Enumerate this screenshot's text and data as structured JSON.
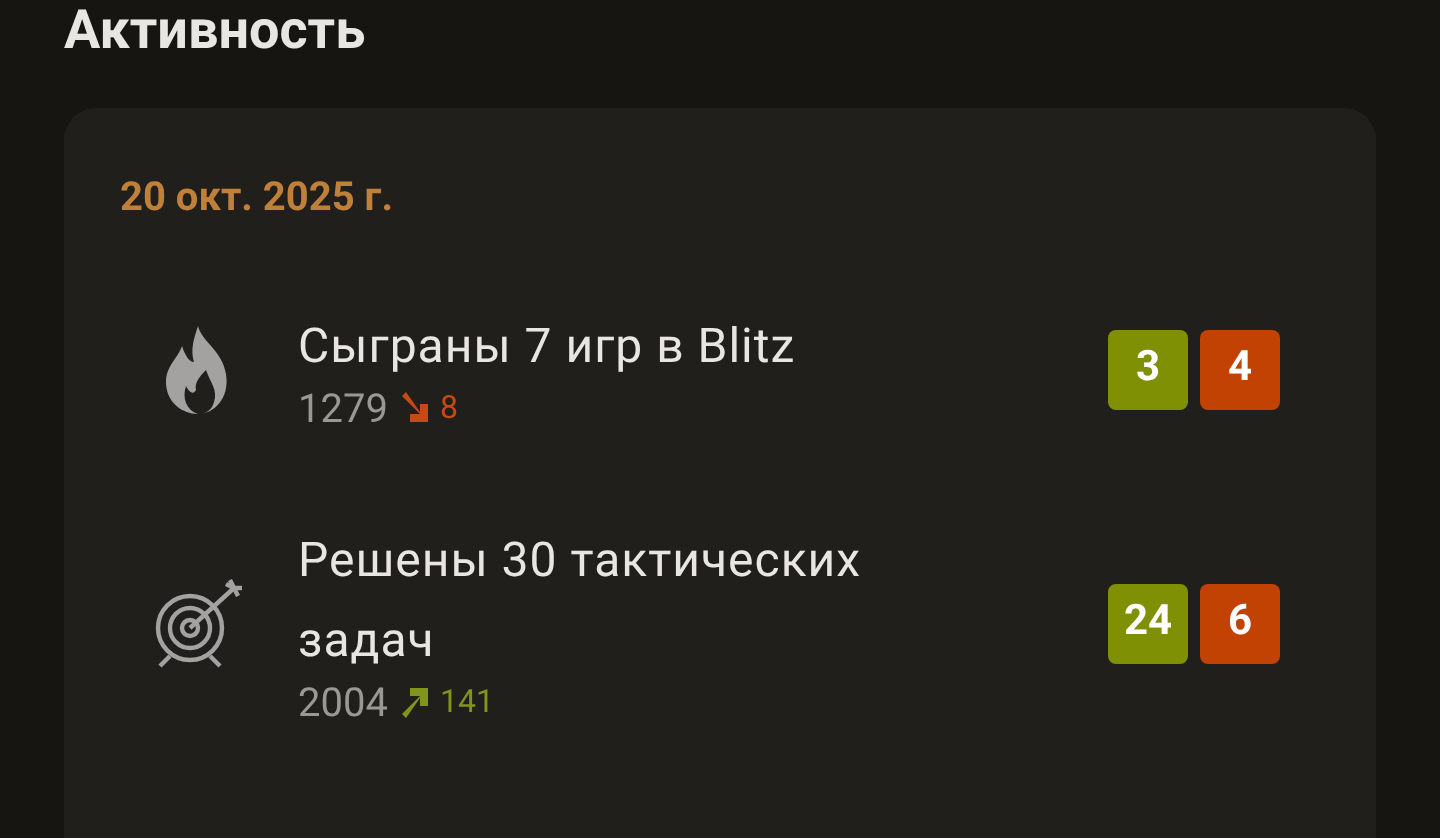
{
  "title": "Активность",
  "date": "20 окт. 2025 г.",
  "items": [
    {
      "kind": "games",
      "text": "Сыграны 7 игр в Blitz",
      "rating": "1279",
      "rising": false,
      "change": "8",
      "badges": [
        {
          "kind": "win",
          "text": "3"
        },
        {
          "kind": "loss",
          "text": "4"
        }
      ]
    },
    {
      "kind": "puzzles",
      "text": "Решены 30 тактических задач",
      "rating": "2004",
      "rising": true,
      "change": "141",
      "badges": [
        {
          "kind": "win",
          "text": "24"
        },
        {
          "kind": "loss",
          "text": "6"
        }
      ]
    }
  ]
}
